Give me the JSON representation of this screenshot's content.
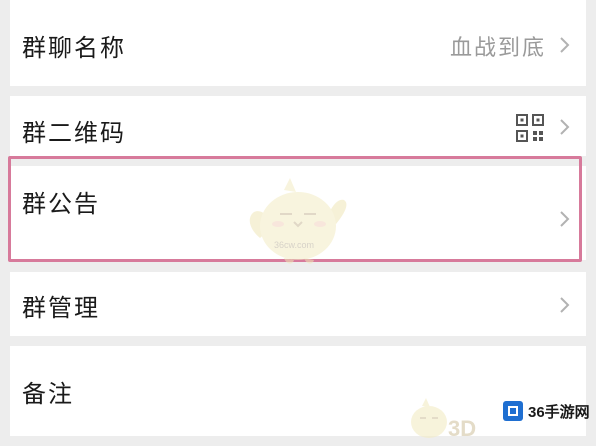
{
  "rows": [
    {
      "label": "群聊名称",
      "value": "血战到底"
    },
    {
      "label": "群二维码",
      "trailing_icon": "qr-code-icon"
    },
    {
      "label": "群公告"
    },
    {
      "label": "群管理"
    },
    {
      "label": "备注"
    }
  ],
  "icons": {
    "chevron": "chevron-right-icon",
    "qr": "qr-code-icon"
  },
  "colors": {
    "background": "#ededed",
    "card": "#ffffff",
    "label": "#1a1a1a",
    "value": "#9a9a9a",
    "chevron": "#b2b2b2",
    "highlight_border": "#d77a9b"
  },
  "watermark": {
    "brand": "36手游网",
    "site": "3D",
    "small": "36cw.com"
  }
}
